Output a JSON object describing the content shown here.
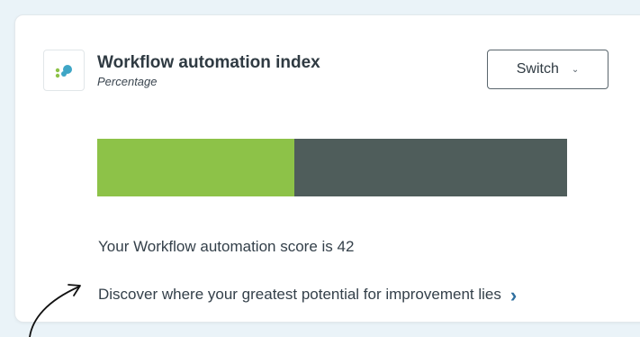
{
  "widget": {
    "title": "Workflow automation index",
    "subtitle": "Percentage",
    "switch_label": "Switch",
    "score_text": "Your Workflow automation score is 42",
    "score_value": 42,
    "link_text": "Discover where your greatest potential for improvement lies"
  },
  "icons": {
    "logo": "dots-logo-icon",
    "switch_chevron": "chevron-down-icon",
    "link_chevron": "chevron-right-icon",
    "annotation": "hand-drawn-arrow-icon"
  },
  "colors": {
    "bar_fill": "#8dc248",
    "bar_track": "#4f5d5b",
    "link_chevron": "#2f6f9f",
    "page_background": "#eaf3f8"
  }
}
